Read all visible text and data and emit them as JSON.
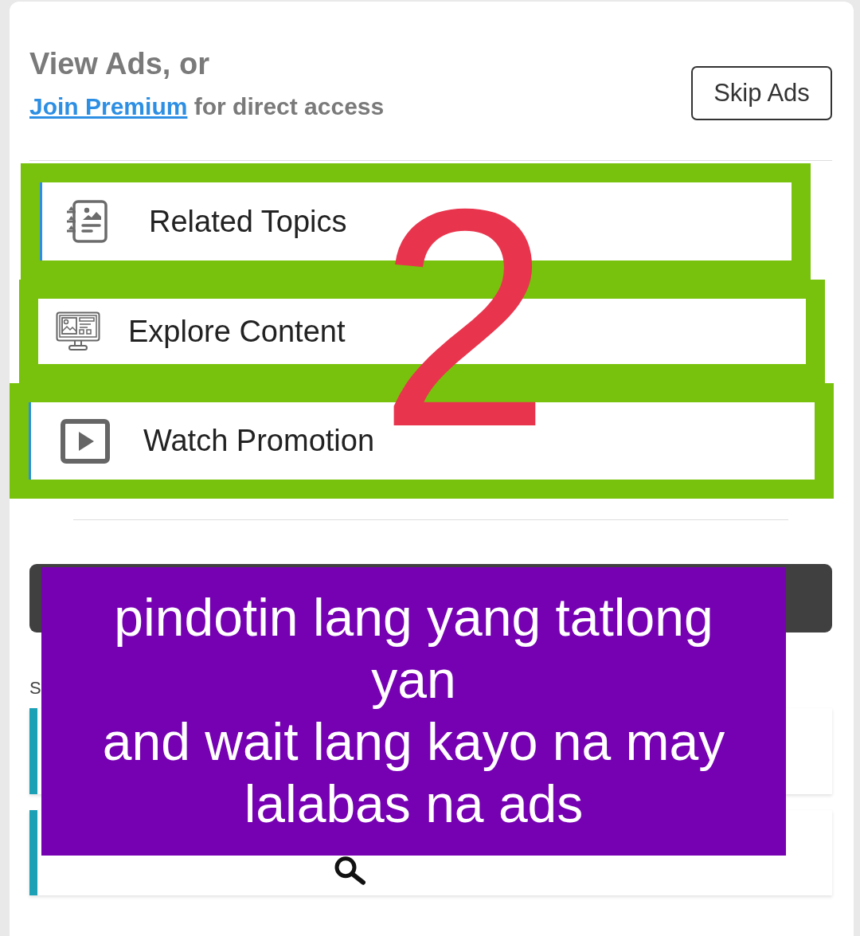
{
  "header": {
    "title": "View Ads, or",
    "subtitle": {
      "link": "Join Premium",
      "text": "for direct access"
    },
    "skip_button": "Skip Ads"
  },
  "options": [
    {
      "label": "Related Topics",
      "highlighted": true
    },
    {
      "label": "Explore Content",
      "highlighted": true
    },
    {
      "label": "Watch Promotion",
      "highlighted": true
    }
  ],
  "section": {
    "heading": "S",
    "cards": [
      {
        "kind": "blank"
      },
      {
        "kind": "search"
      }
    ]
  },
  "annotation": {
    "step_number": "2",
    "caption": [
      "pindotin lang yang tatlong yan",
      "and wait lang kayo na may lalabas na ads"
    ]
  }
}
